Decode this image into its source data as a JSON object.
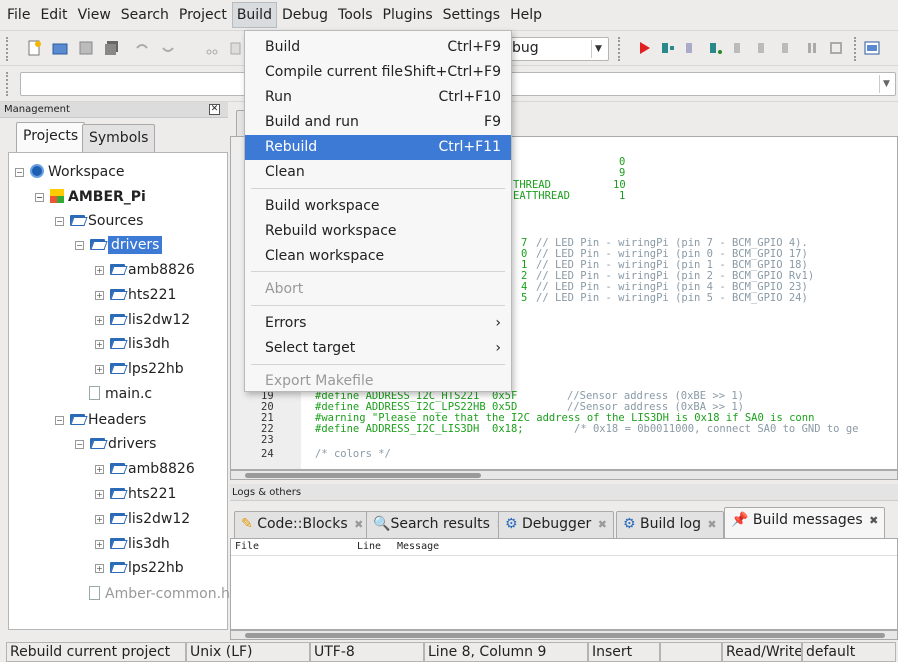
{
  "menubar": {
    "items": [
      "File",
      "Edit",
      "View",
      "Search",
      "Project",
      "Build",
      "Debug",
      "Tools",
      "Plugins",
      "Settings",
      "Help"
    ],
    "active": "Build"
  },
  "toolbar": {
    "target_value": "bug"
  },
  "build_menu": {
    "items": [
      {
        "label": "Build",
        "shortcut": "Ctrl+F9"
      },
      {
        "label": "Compile current file",
        "shortcut": "Shift+Ctrl+F9"
      },
      {
        "label": "Run",
        "shortcut": "Ctrl+F10"
      },
      {
        "label": "Build and run",
        "shortcut": "F9"
      },
      {
        "label": "Rebuild",
        "shortcut": "Ctrl+F11",
        "selected": true
      },
      {
        "label": "Clean",
        "shortcut": ""
      },
      {
        "label": "Build workspace",
        "shortcut": ""
      },
      {
        "label": "Rebuild workspace",
        "shortcut": ""
      },
      {
        "label": "Clean workspace",
        "shortcut": ""
      },
      {
        "label": "Abort",
        "shortcut": "",
        "disabled": true
      },
      {
        "label": "Errors",
        "shortcut": "›"
      },
      {
        "label": "Select target",
        "shortcut": "›"
      },
      {
        "label": "Export Makefile",
        "shortcut": "",
        "disabled": true
      }
    ]
  },
  "management": {
    "title": "Management",
    "close_label": "☒",
    "tabs": [
      "Projects",
      "Symbols"
    ],
    "tree": {
      "workspace": "Workspace",
      "project": "AMBER_Pi",
      "sources": "Sources",
      "sources_drivers": "drivers",
      "source_driver_items": [
        "amb8826",
        "hts221",
        "lis2dw12",
        "lis3dh",
        "lps22hb"
      ],
      "main_file": "main.c",
      "headers": "Headers",
      "headers_drivers": "drivers",
      "header_driver_items": [
        "amb8826",
        "hts221",
        "lis2dw12",
        "lis3dh",
        "lps22hb"
      ],
      "amber_common": "Amber-common.h"
    }
  },
  "editor": {
    "top_fragments": [
      {
        "text": "0",
        "color": "green"
      },
      {
        "text": "9",
        "color": "green"
      },
      {
        "text": "THREAD",
        "color": "green"
      },
      {
        "text": "10",
        "color": "green"
      },
      {
        "text": "EATTHREAD",
        "color": "green"
      },
      {
        "text": "1",
        "color": "green"
      }
    ],
    "led_lines": [
      {
        "pin": "7",
        "comment": "// LED Pin - wiringPi (pin 7 - BCM_GPIO 4)."
      },
      {
        "pin": "0",
        "comment": "// LED Pin - wiringPi (pin 0 - BCM_GPIO 17)"
      },
      {
        "pin": "1",
        "comment": "// LED Pin - wiringPi (pin 1 - BCM_GPIO 18)"
      },
      {
        "pin": "2",
        "comment": "// LED Pin - wiringPi (pin 2 - BCM_GPIO Rv1)"
      },
      {
        "pin": "4",
        "comment": "// LED Pin - wiringPi (pin 4 - BCM_GPIO 23)"
      },
      {
        "pin": "5",
        "comment": "// LED Pin - wiringPi (pin 5 - BCM_GPIO 24)"
      }
    ],
    "bottom_lines": [
      {
        "num": "19",
        "code": "#define ADDRESS_I2C_HTS221  0x5F",
        "comment": "//Sensor address (0xBE >> 1)"
      },
      {
        "num": "20",
        "code": "#define ADDRESS_I2C_LPS22HB 0x5D",
        "comment": "//Sensor address (0xBA >> 1)"
      },
      {
        "num": "21",
        "code": "#warning \"Please note that the I2C address of the LIS3DH is 0x18 if SA0 is conn",
        "comment": ""
      },
      {
        "num": "22",
        "code": "#define ADDRESS_I2C_LIS3DH  0x18;",
        "comment": "/* 0x18 = 0b0011000, connect SA0 to GND to ge"
      },
      {
        "num": "23",
        "code": "",
        "comment": ""
      },
      {
        "num": "24",
        "code": "",
        "comment": "/* colors */"
      }
    ]
  },
  "logs": {
    "title": "Logs & others",
    "tabs": [
      "Code::Blocks",
      "Search results",
      "Debugger",
      "Build log",
      "Build messages"
    ],
    "close_glyph": "✖",
    "columns": [
      "File",
      "Line",
      "Message"
    ]
  },
  "status": {
    "message": "Rebuild current project",
    "eol": "Unix (LF)",
    "encoding": "UTF-8",
    "position": "Line 8, Column 9",
    "mode": "Insert",
    "blank": "",
    "access": "Read/Write",
    "lang": "default"
  },
  "colors": {
    "selection": "#3d7ad6",
    "code_green": "#1ca01c",
    "comment_gray": "#8a9aa6"
  }
}
